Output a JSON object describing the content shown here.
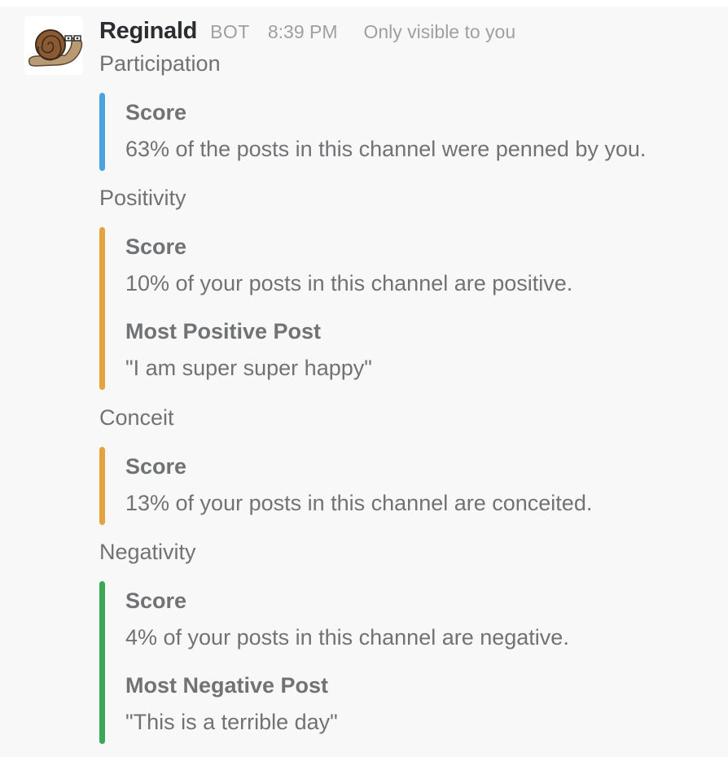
{
  "message": {
    "sender": "Reginald",
    "badge": "BOT",
    "time": "8:39 PM",
    "visibility": "Only visible to you",
    "avatar_icon": "snail-with-glasses-icon"
  },
  "sections": [
    {
      "title": "Participation",
      "color": "#4aa3df",
      "fields": [
        {
          "title": "Score",
          "value": "63% of the posts in this channel were penned by you."
        }
      ]
    },
    {
      "title": "Positivity",
      "color": "#e4a33f",
      "fields": [
        {
          "title": "Score",
          "value": "10% of your posts in this channel are positive."
        },
        {
          "title": "Most Positive Post",
          "value": "\"I am super super happy\""
        }
      ]
    },
    {
      "title": "Conceit",
      "color": "#e4a33f",
      "fields": [
        {
          "title": "Score",
          "value": "13% of your posts in this channel are conceited."
        }
      ]
    },
    {
      "title": "Negativity",
      "color": "#3aa856",
      "fields": [
        {
          "title": "Score",
          "value": "4% of your posts in this channel are negative."
        },
        {
          "title": "Most Negative Post",
          "value": "\"This is a terrible day\""
        }
      ]
    }
  ]
}
